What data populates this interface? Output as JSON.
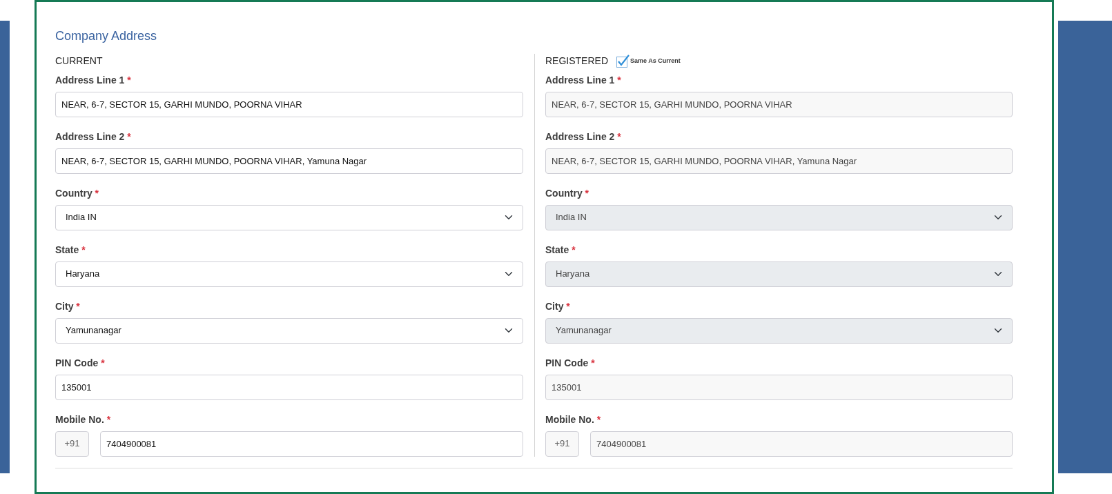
{
  "title": "Company Address",
  "sections": [
    {
      "heading": "CURRENT",
      "disabled": false,
      "fields": [
        {
          "kind": "text",
          "label": "Address Line 1",
          "required_mark": "*",
          "value": "NEAR, 6-7, SECTOR 15, GARHI MUNDO, POORNA VIHAR"
        },
        {
          "kind": "text",
          "label": "Address Line 2",
          "required_mark": "*",
          "value": "NEAR, 6-7, SECTOR 15, GARHI MUNDO, POORNA VIHAR, Yamuna Nagar"
        },
        {
          "kind": "select",
          "label": "Country",
          "required_mark": "*",
          "value": "India IN"
        },
        {
          "kind": "select",
          "label": "State",
          "required_mark": "*",
          "value": "Haryana"
        },
        {
          "kind": "select",
          "label": "City",
          "required_mark": "*",
          "value": "Yamunanagar"
        },
        {
          "kind": "text",
          "label": "PIN Code",
          "required_mark": "*",
          "value": "135001"
        },
        {
          "kind": "phone",
          "label": "Mobile No.",
          "required_mark": "*",
          "prefix": "+91",
          "value": "7404900081"
        }
      ]
    },
    {
      "heading": "REGISTERED",
      "same_as_current": {
        "label": "Same As Current",
        "checked": true
      },
      "disabled": true,
      "fields": [
        {
          "kind": "text",
          "label": "Address Line 1",
          "required_mark": "*",
          "value": "NEAR, 6-7, SECTOR 15, GARHI MUNDO, POORNA VIHAR"
        },
        {
          "kind": "text",
          "label": "Address Line 2",
          "required_mark": "*",
          "value": "NEAR, 6-7, SECTOR 15, GARHI MUNDO, POORNA VIHAR, Yamuna Nagar"
        },
        {
          "kind": "select",
          "label": "Country",
          "required_mark": "*",
          "value": "India IN"
        },
        {
          "kind": "select",
          "label": "State",
          "required_mark": "*",
          "value": "Haryana"
        },
        {
          "kind": "select",
          "label": "City",
          "required_mark": "*",
          "value": "Yamunanagar"
        },
        {
          "kind": "text",
          "label": "PIN Code",
          "required_mark": "*",
          "value": "135001"
        },
        {
          "kind": "phone",
          "label": "Mobile No.",
          "required_mark": "*",
          "prefix": "+91",
          "value": "7404900081"
        }
      ]
    }
  ]
}
